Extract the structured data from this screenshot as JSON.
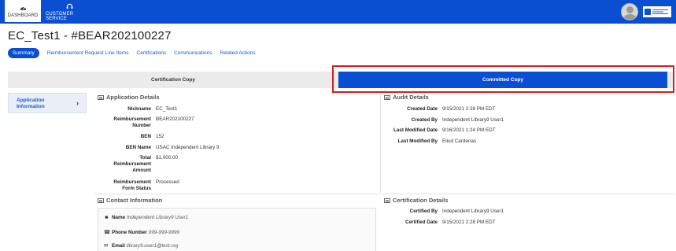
{
  "nav": {
    "dashboard_label": "DASHBOARD",
    "customer_service_label": "CUSTOMER SERVICE",
    "accent_color": "#0a4fd1"
  },
  "page": {
    "title": "EC_Test1 - #BEAR202100227"
  },
  "tabs": [
    {
      "label": "Summary",
      "active": true
    },
    {
      "label": "Reimbursement Request Line Items"
    },
    {
      "label": "Certifications"
    },
    {
      "label": "Communications"
    },
    {
      "label": "Related Actions"
    }
  ],
  "copy_toggle": {
    "certification_label": "Certification Copy",
    "committed_label": "Committed Copy",
    "selected": "Committed Copy"
  },
  "sidebar": {
    "item_label": "Application Information"
  },
  "application_details": {
    "heading": "Application Details",
    "fields": [
      {
        "label": "Nickname",
        "value": "EC_Test1"
      },
      {
        "label": "Reimbursement Number",
        "value": "BEAR202100227"
      },
      {
        "label": "BEN",
        "value": "152"
      },
      {
        "label": "BEN Name",
        "value": "USAC Independent Library 9"
      },
      {
        "label": "Total Reimbursement Amount",
        "value": "$1,000.00"
      },
      {
        "label": "Reimbursement Form Status",
        "value": "Processed"
      }
    ]
  },
  "audit_details": {
    "heading": "Audit Details",
    "fields": [
      {
        "label": "Created Date",
        "value": "9/15/2021 2:28 PM EDT"
      },
      {
        "label": "Created By",
        "value": "Independent Library9 User1"
      },
      {
        "label": "Last Modified Date",
        "value": "9/16/2021 1:24 PM EDT"
      },
      {
        "label": "Last Modified By",
        "value": "Eliud Cardenas"
      }
    ]
  },
  "contact_information": {
    "heading": "Contact Information",
    "rows": [
      {
        "icon": "person-icon",
        "label": "Name",
        "value": "Independent Library9 User1"
      },
      {
        "icon": "phone-icon",
        "label": "Phone Number",
        "value": "999-999-9999"
      },
      {
        "icon": "envelope-icon",
        "label": "Email",
        "value": "library9.user1@test.org"
      }
    ]
  },
  "certification_details": {
    "heading": "Certification Details",
    "fields": [
      {
        "label": "Certified By",
        "value": "Independent Library9 User1"
      },
      {
        "label": "Certified Date",
        "value": "9/15/2021 2:28 PM EDT"
      }
    ]
  }
}
